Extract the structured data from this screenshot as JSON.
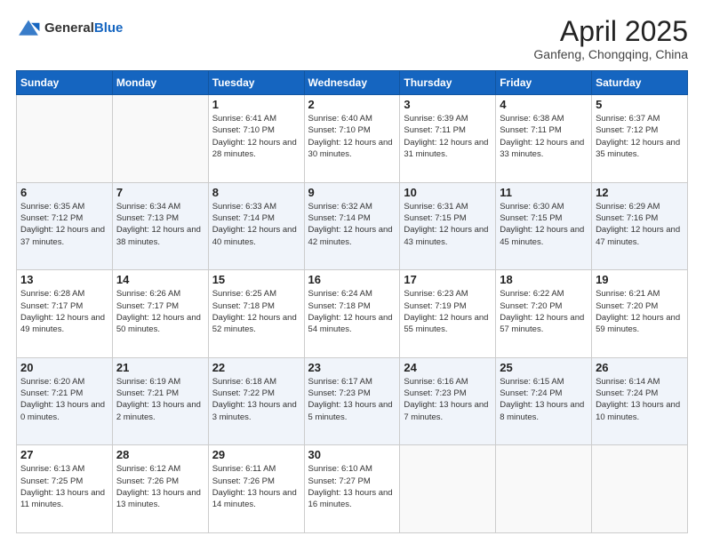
{
  "header": {
    "logo_general": "General",
    "logo_blue": "Blue",
    "title": "April 2025",
    "location": "Ganfeng, Chongqing, China"
  },
  "weekdays": [
    "Sunday",
    "Monday",
    "Tuesday",
    "Wednesday",
    "Thursday",
    "Friday",
    "Saturday"
  ],
  "weeks": [
    [
      {
        "day": "",
        "info": ""
      },
      {
        "day": "",
        "info": ""
      },
      {
        "day": "1",
        "info": "Sunrise: 6:41 AM\nSunset: 7:10 PM\nDaylight: 12 hours and 28 minutes."
      },
      {
        "day": "2",
        "info": "Sunrise: 6:40 AM\nSunset: 7:10 PM\nDaylight: 12 hours and 30 minutes."
      },
      {
        "day": "3",
        "info": "Sunrise: 6:39 AM\nSunset: 7:11 PM\nDaylight: 12 hours and 31 minutes."
      },
      {
        "day": "4",
        "info": "Sunrise: 6:38 AM\nSunset: 7:11 PM\nDaylight: 12 hours and 33 minutes."
      },
      {
        "day": "5",
        "info": "Sunrise: 6:37 AM\nSunset: 7:12 PM\nDaylight: 12 hours and 35 minutes."
      }
    ],
    [
      {
        "day": "6",
        "info": "Sunrise: 6:35 AM\nSunset: 7:12 PM\nDaylight: 12 hours and 37 minutes."
      },
      {
        "day": "7",
        "info": "Sunrise: 6:34 AM\nSunset: 7:13 PM\nDaylight: 12 hours and 38 minutes."
      },
      {
        "day": "8",
        "info": "Sunrise: 6:33 AM\nSunset: 7:14 PM\nDaylight: 12 hours and 40 minutes."
      },
      {
        "day": "9",
        "info": "Sunrise: 6:32 AM\nSunset: 7:14 PM\nDaylight: 12 hours and 42 minutes."
      },
      {
        "day": "10",
        "info": "Sunrise: 6:31 AM\nSunset: 7:15 PM\nDaylight: 12 hours and 43 minutes."
      },
      {
        "day": "11",
        "info": "Sunrise: 6:30 AM\nSunset: 7:15 PM\nDaylight: 12 hours and 45 minutes."
      },
      {
        "day": "12",
        "info": "Sunrise: 6:29 AM\nSunset: 7:16 PM\nDaylight: 12 hours and 47 minutes."
      }
    ],
    [
      {
        "day": "13",
        "info": "Sunrise: 6:28 AM\nSunset: 7:17 PM\nDaylight: 12 hours and 49 minutes."
      },
      {
        "day": "14",
        "info": "Sunrise: 6:26 AM\nSunset: 7:17 PM\nDaylight: 12 hours and 50 minutes."
      },
      {
        "day": "15",
        "info": "Sunrise: 6:25 AM\nSunset: 7:18 PM\nDaylight: 12 hours and 52 minutes."
      },
      {
        "day": "16",
        "info": "Sunrise: 6:24 AM\nSunset: 7:18 PM\nDaylight: 12 hours and 54 minutes."
      },
      {
        "day": "17",
        "info": "Sunrise: 6:23 AM\nSunset: 7:19 PM\nDaylight: 12 hours and 55 minutes."
      },
      {
        "day": "18",
        "info": "Sunrise: 6:22 AM\nSunset: 7:20 PM\nDaylight: 12 hours and 57 minutes."
      },
      {
        "day": "19",
        "info": "Sunrise: 6:21 AM\nSunset: 7:20 PM\nDaylight: 12 hours and 59 minutes."
      }
    ],
    [
      {
        "day": "20",
        "info": "Sunrise: 6:20 AM\nSunset: 7:21 PM\nDaylight: 13 hours and 0 minutes."
      },
      {
        "day": "21",
        "info": "Sunrise: 6:19 AM\nSunset: 7:21 PM\nDaylight: 13 hours and 2 minutes."
      },
      {
        "day": "22",
        "info": "Sunrise: 6:18 AM\nSunset: 7:22 PM\nDaylight: 13 hours and 3 minutes."
      },
      {
        "day": "23",
        "info": "Sunrise: 6:17 AM\nSunset: 7:23 PM\nDaylight: 13 hours and 5 minutes."
      },
      {
        "day": "24",
        "info": "Sunrise: 6:16 AM\nSunset: 7:23 PM\nDaylight: 13 hours and 7 minutes."
      },
      {
        "day": "25",
        "info": "Sunrise: 6:15 AM\nSunset: 7:24 PM\nDaylight: 13 hours and 8 minutes."
      },
      {
        "day": "26",
        "info": "Sunrise: 6:14 AM\nSunset: 7:24 PM\nDaylight: 13 hours and 10 minutes."
      }
    ],
    [
      {
        "day": "27",
        "info": "Sunrise: 6:13 AM\nSunset: 7:25 PM\nDaylight: 13 hours and 11 minutes."
      },
      {
        "day": "28",
        "info": "Sunrise: 6:12 AM\nSunset: 7:26 PM\nDaylight: 13 hours and 13 minutes."
      },
      {
        "day": "29",
        "info": "Sunrise: 6:11 AM\nSunset: 7:26 PM\nDaylight: 13 hours and 14 minutes."
      },
      {
        "day": "30",
        "info": "Sunrise: 6:10 AM\nSunset: 7:27 PM\nDaylight: 13 hours and 16 minutes."
      },
      {
        "day": "",
        "info": ""
      },
      {
        "day": "",
        "info": ""
      },
      {
        "day": "",
        "info": ""
      }
    ]
  ]
}
